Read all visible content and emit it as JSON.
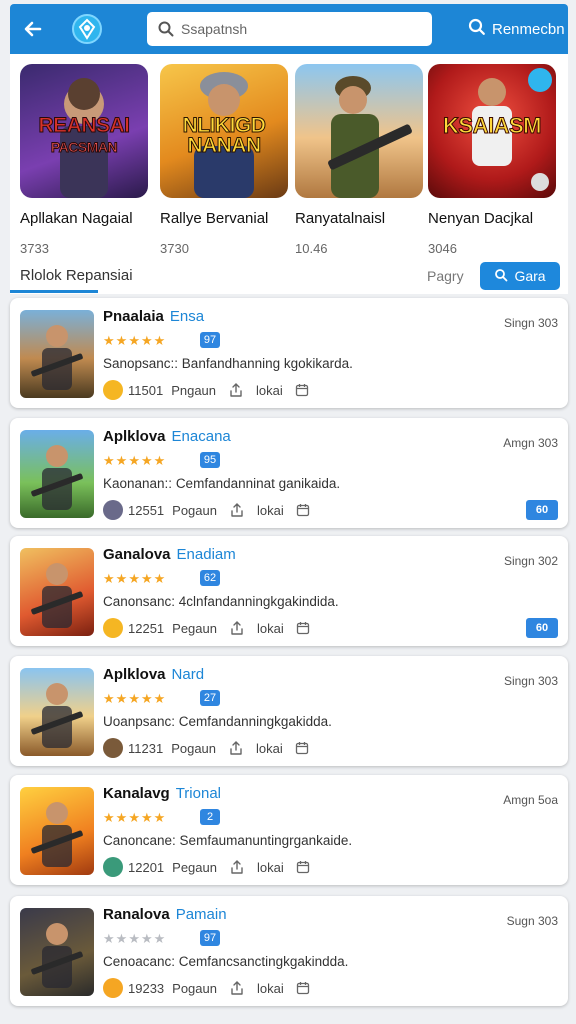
{
  "header": {
    "search_placeholder": "Ssapatnsh",
    "search_button": "Renmecbn"
  },
  "featured": {
    "items": [
      {
        "name": "Apllakan Nagaial",
        "count": "3733",
        "art": "REANSAI\nPACSMAN"
      },
      {
        "name": "Rallye Bervanial",
        "count": "3730",
        "art": "NLIKIGD\nNANAN"
      },
      {
        "name": "Ranyatalnaisl",
        "count": "10.46",
        "art": ""
      },
      {
        "name": "Nenyan Dacjkal",
        "count": "3046",
        "art": "KSAIASM"
      }
    ],
    "tab_label": "Rlolok Repansiai",
    "pager_label": "Pagry",
    "action_label": "Gara"
  },
  "apps": [
    {
      "title": "Pnaalaia",
      "subtitle": "Ensa",
      "rating": 5,
      "badge": "97",
      "description": "Sanopsanc:: Banfandhanning kgokikarda.",
      "count": "11501",
      "label1": "Pngaun",
      "label2": "lokai",
      "right_label": "Singn 303",
      "action": ""
    },
    {
      "title": "Aplklova",
      "subtitle": "Enacana",
      "rating": 5,
      "badge": "95",
      "description": "Kaonanan:: Cemfandanninat ganikaida.",
      "count": "12551",
      "label1": "Pogaun",
      "label2": "lokai",
      "right_label": "Amgn 303",
      "action": "60"
    },
    {
      "title": "Ganalova",
      "subtitle": "Enadiam",
      "rating": 5,
      "badge": "62",
      "description": "Canonsanc: 4clnfandanningkgakindida.",
      "count": "12251",
      "label1": "Pegaun",
      "label2": "lokai",
      "right_label": "Singn 302",
      "action": "60"
    },
    {
      "title": "Aplklova",
      "subtitle": "Nard",
      "rating": 5,
      "badge": "27",
      "description": "Uoanpsanc: Cemfandanningkgakidda.",
      "count": "11231",
      "label1": "Pogaun",
      "label2": "lokai",
      "right_label": "Singn 303",
      "action": ""
    },
    {
      "title": "Kanalavg",
      "subtitle": "Trional",
      "rating": 5,
      "badge": "2",
      "description": "Canoncane: Semfaumanuntingrgankaide.",
      "count": "12201",
      "label1": "Pegaun",
      "label2": "lokai",
      "right_label": "Amgn 5oa",
      "action": ""
    },
    {
      "title": "Ranalova",
      "subtitle": "Pamain",
      "rating": 0,
      "badge": "97",
      "description": "Cenoacanc: Cemfancsanctingkgakindda.",
      "count": "19233",
      "label1": "Pogaun",
      "label2": "lokai",
      "right_label": "Sugn 303",
      "action": ""
    }
  ],
  "colors": {
    "accent": "#1d86d6",
    "star": "#f5a623",
    "badge": "#2f86e0"
  }
}
